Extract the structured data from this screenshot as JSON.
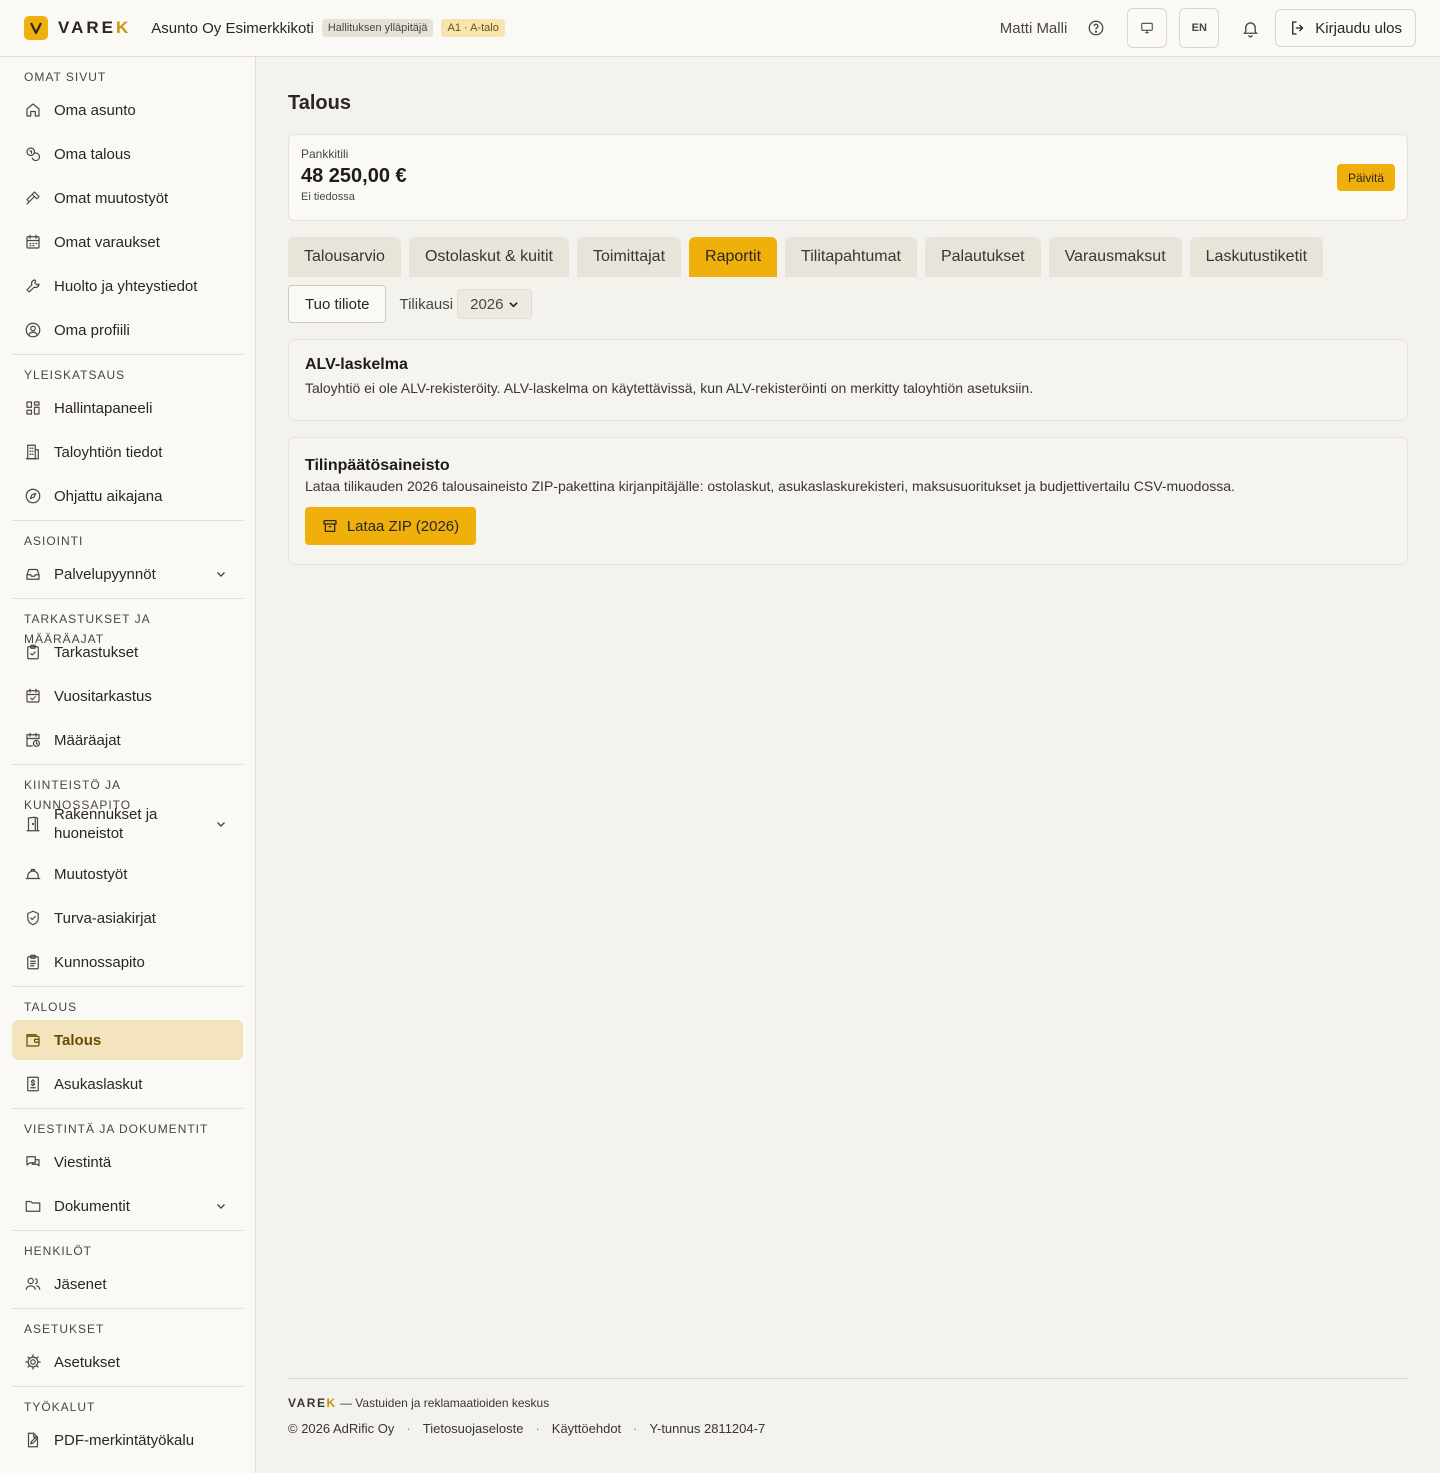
{
  "header": {
    "logo_text": "VARE",
    "logo_k": "K",
    "org_name": "Asunto Oy Esimerkkikoti",
    "role_badge": "Hallituksen ylläpitäjä",
    "unit_badge": "A1 · A-talo",
    "user_name": "Matti Malli",
    "lang_label": "EN",
    "logout_label": "Kirjaudu ulos"
  },
  "sidebar": {
    "sections": [
      {
        "title": "OMAT SIVUT",
        "items": [
          {
            "label": "Oma asunto",
            "icon": "home-icon"
          },
          {
            "label": "Oma talous",
            "icon": "coins-icon"
          },
          {
            "label": "Omat muutostyöt",
            "icon": "hammer-icon"
          },
          {
            "label": "Omat varaukset",
            "icon": "calendar-icon"
          },
          {
            "label": "Huolto ja yhteystiedot",
            "icon": "wrench-icon"
          },
          {
            "label": "Oma profiili",
            "icon": "user-circle-icon"
          }
        ]
      },
      {
        "title": "YLEISKATSAUS",
        "items": [
          {
            "label": "Hallintapaneeli",
            "icon": "dashboard-icon"
          },
          {
            "label": "Taloyhtiön tiedot",
            "icon": "building-icon"
          },
          {
            "label": "Ohjattu aikajana",
            "icon": "compass-icon"
          }
        ]
      },
      {
        "title": "ASIOINTI",
        "items": [
          {
            "label": "Palvelupyynnöt",
            "icon": "inbox-icon",
            "expandable": true
          }
        ]
      },
      {
        "title": "TARKASTUKSET JA MÄÄRÄAJAT",
        "items": [
          {
            "label": "Tarkastukset",
            "icon": "clipboard-check-icon"
          },
          {
            "label": "Vuositarkastus",
            "icon": "calendar-check-icon"
          },
          {
            "label": "Määräajat",
            "icon": "calendar-clock-icon"
          }
        ]
      },
      {
        "title": "KIINTEISTÖ JA KUNNOSSAPITO",
        "items": [
          {
            "label": "Rakennukset ja huoneistot",
            "icon": "door-icon",
            "expandable": true
          },
          {
            "label": "Muutostyöt",
            "icon": "hardhat-icon"
          },
          {
            "label": "Turva-asiakirjat",
            "icon": "shield-check-icon"
          },
          {
            "label": "Kunnossapito",
            "icon": "clipboard-list-icon"
          }
        ]
      },
      {
        "title": "TALOUS",
        "items": [
          {
            "label": "Talous",
            "icon": "wallet-icon",
            "active": true
          },
          {
            "label": "Asukaslaskut",
            "icon": "receipt-icon"
          }
        ]
      },
      {
        "title": "VIESTINTÄ JA DOKUMENTIT",
        "items": [
          {
            "label": "Viestintä",
            "icon": "chat-icon"
          },
          {
            "label": "Dokumentit",
            "icon": "folder-icon",
            "expandable": true
          }
        ]
      },
      {
        "title": "HENKILÖT",
        "items": [
          {
            "label": "Jäsenet",
            "icon": "users-icon"
          }
        ]
      },
      {
        "title": "ASETUKSET",
        "items": [
          {
            "label": "Asetukset",
            "icon": "gear-icon"
          }
        ]
      },
      {
        "title": "TYÖKALUT",
        "items": [
          {
            "label": "PDF-merkintätyökalu",
            "icon": "file-pen-icon"
          }
        ]
      }
    ]
  },
  "main": {
    "title": "Talous",
    "bank": {
      "label": "Pankkitili",
      "amount": "48 250,00 €",
      "status": "Ei tiedossa",
      "refresh_label": "Päivitä"
    },
    "tabs": [
      {
        "label": "Talousarvio"
      },
      {
        "label": "Ostolaskut & kuitit"
      },
      {
        "label": "Toimittajat"
      },
      {
        "label": "Raportit",
        "active": true
      },
      {
        "label": "Tilitapahtumat"
      },
      {
        "label": "Palautukset"
      },
      {
        "label": "Varausmaksut"
      },
      {
        "label": "Laskutustiketit"
      }
    ],
    "import_label": "Tuo tiliote",
    "period_label": "Tilikausi",
    "period_value": "2026",
    "alv": {
      "title": "ALV-laskelma",
      "text": "Taloyhtiö ei ole ALV-rekisteröity. ALV-laskelma on käytettävissä, kun ALV-rekisteröinti on merkitty taloyhtiön asetuksiin."
    },
    "closing": {
      "title": "Tilinpäätösaineisto",
      "text": "Lataa tilikauden 2026 talousaineisto ZIP-pakettina kirjanpitäjälle: ostolaskut, asukaslaskurekisteri, maksusuoritukset ja budjettivertailu CSV-muodossa.",
      "button_label": "Lataa ZIP (2026)"
    }
  },
  "footer": {
    "brand": "VARE",
    "brand_k": "K",
    "tagline": "— Vastuiden ja reklamaatioiden keskus",
    "copyright": "© 2026 AdRific Oy",
    "privacy": "Tietosuojaseloste",
    "terms": "Käyttöehdot",
    "business_id": "Y-tunnus 2811204-7"
  },
  "colors": {
    "accent": "#efb00c",
    "active_nav_bg": "#f4e4bd",
    "page_bg": "#f4f2ec"
  }
}
